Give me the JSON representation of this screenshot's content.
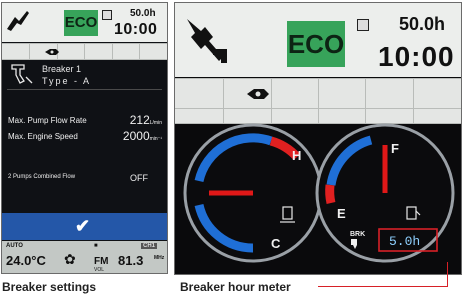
{
  "left_screen": {
    "status": {
      "eco_label": "ECO",
      "hour_meter": "50.0h",
      "clock": "10:00"
    },
    "breaker": {
      "name": "Breaker 1",
      "type": "Type - A"
    },
    "settings": [
      {
        "label": "Max. Pump Flow Rate",
        "value": "212",
        "unit": "L/min"
      },
      {
        "label": "Max. Engine Speed",
        "value": "2000",
        "unit": "min⁻¹"
      },
      {
        "label": "2 Pumps Combined Flow",
        "value": "OFF",
        "unit": ""
      }
    ],
    "confirm_icon": "✔",
    "bottom": {
      "ac_mode": "AUTO",
      "temperature": "24.0°C",
      "radio_band": "FM",
      "channel": "CH1",
      "frequency": "81.3",
      "frequency_unit": "MHz",
      "volume_label": "VOL"
    }
  },
  "right_screen": {
    "status": {
      "eco_label": "ECO",
      "hour_meter": "50.0h",
      "clock": "10:00"
    },
    "temp_gauge": {
      "high_label": "H",
      "cold_label": "C",
      "needle_level": 0.5
    },
    "fuel_gauge": {
      "full_label": "F",
      "empty_label": "E",
      "needle_level": 1.0
    },
    "breaker_hours": {
      "label": "BRK",
      "value": "5.0h"
    }
  },
  "captions": {
    "left": "Breaker settings",
    "right": "Breaker hour meter"
  },
  "colors": {
    "eco": "#37a35a",
    "confirm_bar": "#2457a8",
    "needle": "#e01818",
    "gauge_hot": "#e02020",
    "gauge_cold": "#1f6fd6",
    "callout": "#d72027"
  }
}
